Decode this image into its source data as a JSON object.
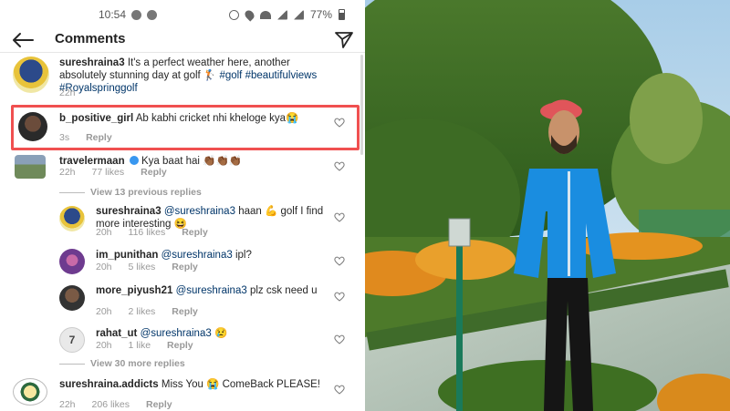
{
  "status": {
    "time": "10:54",
    "battery": "77%"
  },
  "header": {
    "title": "Comments"
  },
  "post": {
    "username": "sureshraina3",
    "text": "It's a perfect weather here, another absolutely stunning day at golf 🏌️",
    "hashtags": "#golf",
    "hashtags2": "#beautifulviews #Royalspringgolf",
    "time": "22h"
  },
  "comments": [
    {
      "username": "b_positive_girl",
      "text": "Ab kabhi cricket nhi khelo​ge kya😭",
      "time": "3s",
      "reply": "Reply"
    },
    {
      "username": "travelermaan",
      "text": "Kya baat hai 👏🏾👏🏾👏🏾",
      "time": "22h",
      "likes": "77 likes",
      "reply": "Reply"
    }
  ],
  "view_previous": "View 13 previous replies",
  "replies": [
    {
      "username": "sureshraina3",
      "mention": "@sureshraina3",
      "text": "haan 💪 golf I find more interesting 😆",
      "time": "20h",
      "likes": "116 likes",
      "reply": "Reply"
    },
    {
      "username": "im_punithan",
      "mention": "@sureshraina3",
      "text": "ipl?",
      "time": "20h",
      "likes": "5 likes",
      "reply": "Reply"
    },
    {
      "username": "more_piyush21",
      "mention": "@sureshraina3",
      "text": "plz csk need u",
      "time": "20h",
      "likes": "2 likes",
      "reply": "Reply"
    },
    {
      "username": "rahat_ut",
      "mention": "@sureshraina3",
      "text": "😢",
      "time": "20h",
      "likes": "1 like",
      "reply": "Reply"
    }
  ],
  "view_more": "View 30 more replies",
  "last_comment": {
    "username": "sureshraina.addicts",
    "text": "Miss You 😭 ComeBack PLEASE!",
    "time": "22h",
    "likes": "206 likes",
    "reply": "Reply"
  },
  "colors": {
    "highlight": "#f05050",
    "link": "#003569",
    "jacket": "#1a8de0",
    "cap": "#e0555a"
  }
}
